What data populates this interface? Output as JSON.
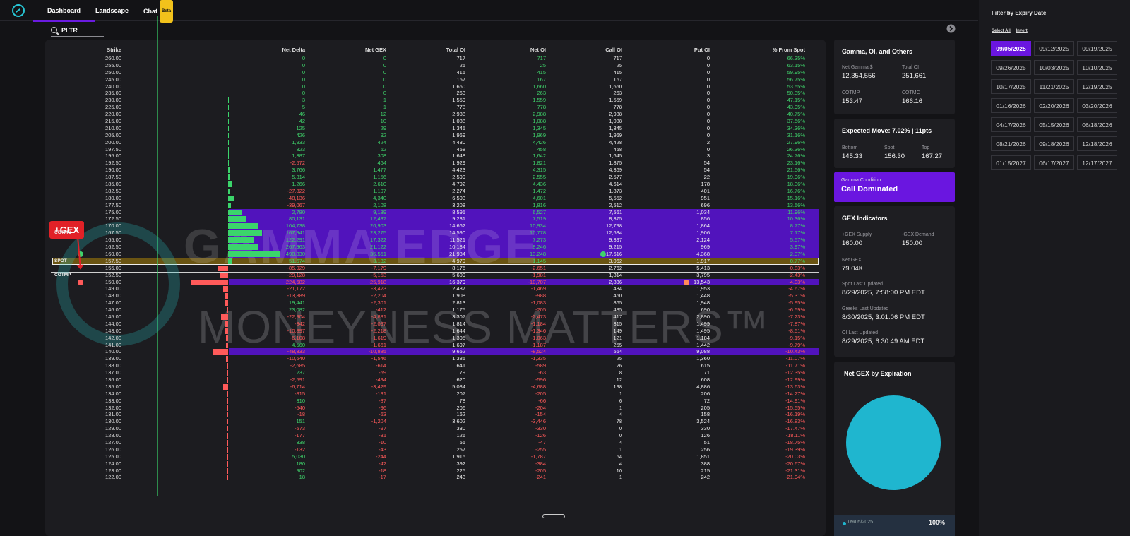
{
  "nav": {
    "tabs": [
      "Dashboard",
      "Landscape",
      "Chat"
    ],
    "beta": "Beta"
  },
  "search": {
    "value": "PLTR"
  },
  "table": {
    "headers": [
      "Strike",
      "Net Delta",
      "Net GEX",
      "Total OI",
      "Net OI",
      "Call OI",
      "Put OI",
      "% From Spot"
    ],
    "rows": [
      [
        "260.00",
        "0",
        "0",
        "717",
        "717",
        "717",
        "0",
        "66.35%"
      ],
      [
        "255.00",
        "0",
        "0",
        "25",
        "25",
        "25",
        "0",
        "63.15%"
      ],
      [
        "250.00",
        "0",
        "0",
        "415",
        "415",
        "415",
        "0",
        "59.95%"
      ],
      [
        "245.00",
        "0",
        "0",
        "167",
        "167",
        "167",
        "0",
        "56.75%"
      ],
      [
        "240.00",
        "0",
        "0",
        "1,660",
        "1,660",
        "1,660",
        "0",
        "53.55%"
      ],
      [
        "235.00",
        "0",
        "0",
        "263",
        "263",
        "263",
        "0",
        "50.35%"
      ],
      [
        "230.00",
        "3",
        "1",
        "1,559",
        "1,559",
        "1,559",
        "0",
        "47.15%"
      ],
      [
        "225.00",
        "5",
        "1",
        "778",
        "778",
        "778",
        "0",
        "43.95%"
      ],
      [
        "220.00",
        "46",
        "12",
        "2,988",
        "2,988",
        "2,988",
        "0",
        "40.75%"
      ],
      [
        "215.00",
        "42",
        "10",
        "1,088",
        "1,088",
        "1,088",
        "0",
        "37.56%"
      ],
      [
        "210.00",
        "125",
        "29",
        "1,345",
        "1,345",
        "1,345",
        "0",
        "34.36%"
      ],
      [
        "205.00",
        "426",
        "92",
        "1,969",
        "1,969",
        "1,969",
        "0",
        "31.16%"
      ],
      [
        "200.00",
        "1,933",
        "424",
        "4,430",
        "4,426",
        "4,428",
        "2",
        "27.96%"
      ],
      [
        "197.50",
        "323",
        "62",
        "458",
        "458",
        "458",
        "0",
        "26.36%"
      ],
      [
        "195.00",
        "1,387",
        "308",
        "1,648",
        "1,642",
        "1,645",
        "3",
        "24.76%"
      ],
      [
        "192.50",
        "-2,572",
        "464",
        "1,929",
        "1,821",
        "1,875",
        "54",
        "23.16%"
      ],
      [
        "190.00",
        "3,766",
        "1,477",
        "4,423",
        "4,315",
        "4,369",
        "54",
        "21.56%"
      ],
      [
        "187.50",
        "5,314",
        "1,156",
        "2,599",
        "2,555",
        "2,577",
        "22",
        "19.96%"
      ],
      [
        "185.00",
        "1,266",
        "2,610",
        "4,792",
        "4,436",
        "4,614",
        "178",
        "18.36%"
      ],
      [
        "182.50",
        "-27,822",
        "1,107",
        "2,274",
        "1,472",
        "1,873",
        "401",
        "16.76%"
      ],
      [
        "180.00",
        "-48,136",
        "4,340",
        "6,503",
        "4,601",
        "5,552",
        "951",
        "15.16%"
      ],
      [
        "177.50",
        "-39,067",
        "2,108",
        "3,208",
        "1,816",
        "2,512",
        "696",
        "13.56%"
      ],
      [
        "175.00",
        "2,780",
        "9,139",
        "8,595",
        "6,527",
        "7,561",
        "1,034",
        "11.96%"
      ],
      [
        "172.50",
        "80,131",
        "12,437",
        "9,231",
        "7,519",
        "8,375",
        "856",
        "10.36%"
      ],
      [
        "170.00",
        "104,738",
        "20,903",
        "14,662",
        "10,934",
        "12,798",
        "1,864",
        "8.77%"
      ],
      [
        "167.50",
        "167,941",
        "23,275",
        "14,590",
        "10,778",
        "12,684",
        "1,906",
        "7.17%"
      ],
      [
        "165.00",
        "122,291",
        "17,322",
        "11,521",
        "7,273",
        "9,397",
        "2,124",
        "5.57%"
      ],
      [
        "162.50",
        "267,963",
        "21,122",
        "10,184",
        "8,246",
        "9,215",
        "969",
        "3.97%"
      ],
      [
        "160.00",
        "490,830",
        "35,551",
        "21,984",
        "13,248",
        "17,616",
        "4,368",
        "2.37%"
      ],
      [
        "157.50",
        "51,674",
        "3,132",
        "4,979",
        "1,145",
        "3,062",
        "1,917",
        "0.77%"
      ],
      [
        "155.00",
        "-85,929",
        "-7,179",
        "8,175",
        "-2,651",
        "2,762",
        "5,413",
        "-0.83%"
      ],
      [
        "152.50",
        "-29,128",
        "-5,153",
        "5,609",
        "-1,981",
        "1,814",
        "3,795",
        "-2.43%"
      ],
      [
        "150.00",
        "-224,682",
        "-25,918",
        "16,379",
        "-10,707",
        "2,836",
        "13,543",
        "-4.03%"
      ],
      [
        "149.00",
        "-21,172",
        "-3,423",
        "2,437",
        "-1,469",
        "484",
        "1,953",
        "-4.67%"
      ],
      [
        "148.00",
        "-13,889",
        "-2,204",
        "1,908",
        "-988",
        "460",
        "1,448",
        "-5.31%"
      ],
      [
        "147.00",
        "19,441",
        "-2,301",
        "2,813",
        "-1,083",
        "865",
        "1,948",
        "-5.95%"
      ],
      [
        "146.00",
        "23,082",
        "-412",
        "1,175",
        "-205",
        "485",
        "690",
        "-6.59%"
      ],
      [
        "145.00",
        "-22,904",
        "-4,881",
        "3,307",
        "-2,473",
        "417",
        "2,890",
        "-7.23%"
      ],
      [
        "144.00",
        "-342",
        "-2,097",
        "1,814",
        "-1,184",
        "315",
        "1,499",
        "-7.87%"
      ],
      [
        "143.00",
        "-10,897",
        "-2,218",
        "1,644",
        "-1,346",
        "149",
        "1,495",
        "-8.51%"
      ],
      [
        "142.00",
        "-6,108",
        "-1,619",
        "1,305",
        "-1,063",
        "121",
        "1,184",
        "-9.15%"
      ],
      [
        "141.00",
        "4,560",
        "-1,661",
        "1,697",
        "-1,187",
        "255",
        "1,442",
        "-9.79%"
      ],
      [
        "140.00",
        "-48,333",
        "-10,885",
        "9,652",
        "-8,524",
        "564",
        "9,088",
        "-10.43%"
      ],
      [
        "139.00",
        "-10,640",
        "-1,546",
        "1,385",
        "-1,335",
        "25",
        "1,360",
        "-11.07%"
      ],
      [
        "138.00",
        "-2,685",
        "-614",
        "641",
        "-589",
        "26",
        "615",
        "-11.71%"
      ],
      [
        "137.00",
        "237",
        "-59",
        "79",
        "-63",
        "8",
        "71",
        "-12.35%"
      ],
      [
        "136.00",
        "-2,591",
        "-494",
        "620",
        "-596",
        "12",
        "608",
        "-12.99%"
      ],
      [
        "135.00",
        "-6,714",
        "-3,429",
        "5,084",
        "-4,688",
        "198",
        "4,886",
        "-13.63%"
      ],
      [
        "134.00",
        "-815",
        "-131",
        "207",
        "-205",
        "1",
        "206",
        "-14.27%"
      ],
      [
        "133.00",
        "310",
        "-37",
        "78",
        "-66",
        "6",
        "72",
        "-14.91%"
      ],
      [
        "132.00",
        "-540",
        "-96",
        "206",
        "-204",
        "1",
        "205",
        "-15.55%"
      ],
      [
        "131.00",
        "-18",
        "-63",
        "162",
        "-154",
        "4",
        "158",
        "-16.19%"
      ],
      [
        "130.00",
        "151",
        "-1,204",
        "3,602",
        "-3,446",
        "78",
        "3,524",
        "-16.83%"
      ],
      [
        "129.00",
        "-573",
        "-97",
        "330",
        "-330",
        "0",
        "330",
        "-17.47%"
      ],
      [
        "128.00",
        "-177",
        "-31",
        "126",
        "-126",
        "0",
        "126",
        "-18.11%"
      ],
      [
        "127.00",
        "338",
        "-10",
        "55",
        "-47",
        "4",
        "51",
        "-18.75%"
      ],
      [
        "126.00",
        "-132",
        "-43",
        "257",
        "-255",
        "1",
        "256",
        "-19.39%"
      ],
      [
        "125.00",
        "5,030",
        "-244",
        "1,915",
        "-1,787",
        "64",
        "1,851",
        "-20.03%"
      ],
      [
        "124.00",
        "180",
        "-42",
        "392",
        "-384",
        "4",
        "388",
        "-20.67%"
      ],
      [
        "123.00",
        "902",
        "-18",
        "225",
        "-205",
        "10",
        "215",
        "-21.31%"
      ],
      [
        "122.00",
        "18",
        "-17",
        "243",
        "-241",
        "1",
        "242",
        "-21.94%"
      ]
    ],
    "labels": {
      "cotmc": "COTMC",
      "spot": "SPOT",
      "cotmp": "COTMP"
    },
    "callout": "+GEX"
  },
  "watermark": {
    "line1": "GAMMA EDGE",
    "line2": "MONEYNESS MATTERS™"
  },
  "cards": {
    "summary": {
      "title": "Gamma, OI, and Others",
      "net_gamma_label": "Net Gamma $",
      "net_gamma": "12,354,556",
      "total_oi_label": "Total OI",
      "total_oi": "251,661",
      "cotmp_label": "COTMP",
      "cotmp": "153.47",
      "cotmc_label": "COTMC",
      "cotmc": "166.16"
    },
    "expected": {
      "title": "Expected Move: 7.02% | 11pts",
      "bottom_label": "Bottom",
      "bottom": "145.33",
      "spot_label": "Spot",
      "spot": "156.30",
      "top_label": "Top",
      "top": "167.27"
    },
    "condition": {
      "label": "Gamma Condition",
      "value": "Call Dominated"
    },
    "indicators": {
      "title": "GEX Indicators",
      "supply_label": "+GEX Supply",
      "supply": "160.00",
      "demand_label": "-GEX Demand",
      "demand": "150.00",
      "net_label": "Net GEX",
      "net": "79.04K",
      "spot_updated_label": "Spot Last Updated",
      "spot_updated": "8/29/2025, 7:58:00 PM EDT",
      "greeks_updated_label": "Greeks Last Updated",
      "greeks_updated": "8/30/2025, 3:01:06 PM EDT",
      "oi_updated_label": "OI Last Updated",
      "oi_updated": "8/29/2025, 6:30:49 AM EDT"
    },
    "expiration": {
      "title": "Net GEX by Expiration",
      "legend_label": "09/05/2025",
      "legend_value": "100%"
    }
  },
  "filter": {
    "title": "Filter by Expiry Date",
    "select_all": "Select All",
    "invert": "Invert",
    "dates": [
      "09/05/2025",
      "09/12/2025",
      "09/19/2025",
      "09/26/2025",
      "10/03/2025",
      "10/10/2025",
      "10/17/2025",
      "11/21/2025",
      "12/19/2025",
      "01/16/2026",
      "02/20/2026",
      "03/20/2026",
      "04/17/2026",
      "05/15/2026",
      "06/18/2026",
      "08/21/2026",
      "09/18/2026",
      "12/18/2026",
      "01/15/2027",
      "06/17/2027",
      "12/17/2027"
    ],
    "selected": "09/05/2025"
  },
  "colors": {
    "accent": "#6a16e0",
    "positive": "#3fd36b",
    "negative": "#ff5a5a",
    "pie": "#1fb6cf"
  }
}
